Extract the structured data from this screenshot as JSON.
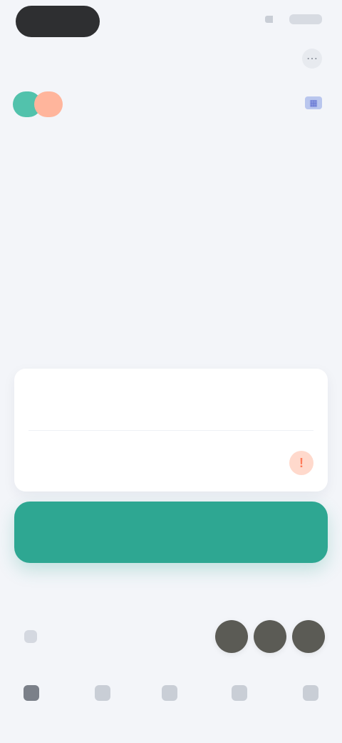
{
  "status_bar": {
    "right_text": ""
  },
  "nav": {
    "title": "",
    "action_icon": "more-icon"
  },
  "header": {
    "meta_text": "",
    "meta_icon": "calendar-icon",
    "chips": [
      "",
      ""
    ]
  },
  "body": {
    "paragraph": ""
  },
  "card": {
    "row1_label": "",
    "row2_label": "",
    "row2_alert_icon": "alert-icon"
  },
  "primary_button": {
    "label": ""
  },
  "note": {
    "text": ""
  },
  "bottom": {
    "left_label": "",
    "left_icon": "chevron-left-icon",
    "avatars": [
      "",
      "",
      ""
    ]
  },
  "tabbar": {
    "tabs": [
      {
        "name": "tab-home",
        "icon": "home-icon"
      },
      {
        "name": "tab-explore",
        "icon": "compass-icon"
      },
      {
        "name": "tab-add",
        "icon": "plus-icon"
      },
      {
        "name": "tab-messages",
        "icon": "chat-icon"
      },
      {
        "name": "tab-profile",
        "icon": "user-icon"
      }
    ]
  },
  "colors": {
    "accent": "#2ea792",
    "chip_teal": "#52c2ac",
    "chip_orange": "#ffb59c",
    "alert": "#ff7a59"
  }
}
